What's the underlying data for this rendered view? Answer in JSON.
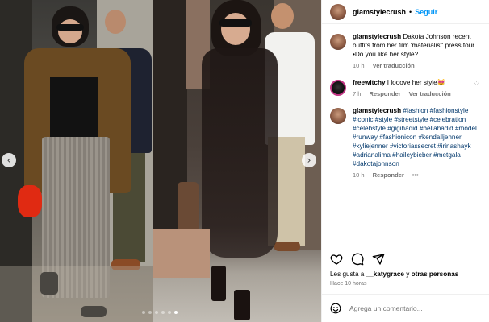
{
  "header": {
    "username": "glamstylecrush",
    "separator": "•",
    "follow_label": "Seguir"
  },
  "caption": {
    "username": "glamstylecrush",
    "text": "Dakota Johnson recent outfits from her film 'materialist' press tour.\n•Do you like her style?",
    "time": "10 h",
    "translate_label": "Ver traducción"
  },
  "comments": [
    {
      "username": "freewitchy",
      "text": "I looove her style😻",
      "time": "7 h",
      "reply_label": "Responder",
      "translate_label": "Ver traducción"
    },
    {
      "username": "glamstylecrush",
      "text": "#fashion #fashionstyle #iconic #style #streetstyle #celebration #celebstyle #gigihadid #bellahadid #model #runway #fashionicon #kendalljenner #kyliejenner #victoriassecret #irinashayk #adrianalima #haileybieber #metgala #dakotajohnson",
      "time": "10 h",
      "reply_label": "Responder",
      "more_label": "•••"
    }
  ],
  "likes": {
    "prefix": "Les gusta a ",
    "user": "__katygrace",
    "suffix": " y ",
    "others": "otras personas"
  },
  "posted": "Hace 10 horas",
  "composer": {
    "placeholder": "Agrega un comentario..."
  },
  "carousel": {
    "slide_count": 6,
    "active_index": 5
  },
  "icons": {
    "emoji": "smiley-icon",
    "like": "heart-icon",
    "comment": "comment-bubble-icon",
    "share": "paper-plane-icon"
  },
  "colors": {
    "link_blue": "#0095f6",
    "hashtag_blue": "#00376b",
    "muted_gray": "#737373"
  }
}
